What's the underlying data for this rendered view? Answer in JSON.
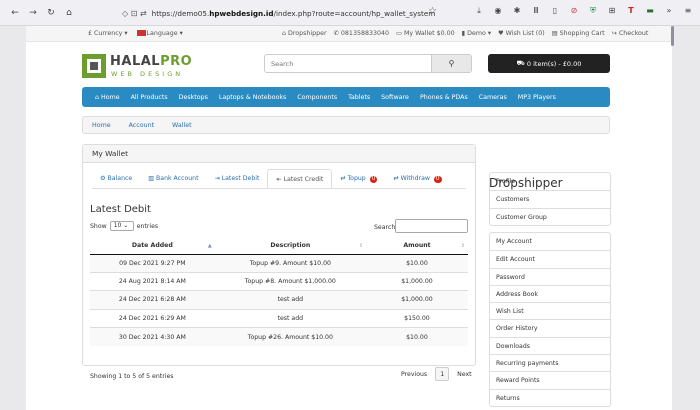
{
  "browser": {
    "url_prefix": "https://demo05.",
    "url_host": "hpwebdesign.id",
    "url_rest": "/index.php?route=account/hp_wallet_system"
  },
  "topnav": {
    "currency": "£ Currency ▾",
    "language": "Language ▾",
    "dropshipper": "Dropshipper",
    "phone": "081358833040",
    "wallet": "My Wallet $0.00",
    "demo": "Demo ▾",
    "wishlist": "Wish List (0)",
    "cart": "Shopping Cart",
    "checkout": "Checkout"
  },
  "header": {
    "brand_main": "HALAL",
    "brand_pro": "PRO",
    "brand_sub": "WEB DESIGN",
    "search_placeholder": "Search",
    "cart_label": "0 item(s) - £0.00"
  },
  "menu": [
    "Home",
    "All Products",
    "Desktops",
    "Laptops & Notebooks",
    "Components",
    "Tablets",
    "Software",
    "Phones & PDAs",
    "Cameras",
    "MP3 Players"
  ],
  "breadcrumb": [
    "Home",
    "Account",
    "Wallet"
  ],
  "wallet": {
    "title": "My Wallet",
    "tabs": [
      {
        "label": "Balance",
        "icon": "gear"
      },
      {
        "label": "Bank Account",
        "icon": "bank"
      },
      {
        "label": "Latest Debit",
        "icon": "sign-out"
      },
      {
        "label": "Latest Credit",
        "icon": "sign-in"
      },
      {
        "label": "Topup",
        "icon": "exchange",
        "badge": "0"
      },
      {
        "label": "Withdraw",
        "icon": "exchange",
        "badge": "0"
      }
    ],
    "section_title": "Latest Debit",
    "show_label": "Show",
    "show_value": "10",
    "entries_label": "entries",
    "search_label": "Search:",
    "columns": [
      "Date Added",
      "Description",
      "Amount"
    ],
    "rows": [
      [
        "09 Dec 2021 9:27 PM",
        "Topup #9. Amount $10.00",
        "$10.00"
      ],
      [
        "24 Aug 2021 8:14 AM",
        "Topup #8. Amount $1,000.00",
        "$1,000.00"
      ],
      [
        "24 Dec 2021 6:28 AM",
        "test add",
        "$1,000.00"
      ],
      [
        "24 Dec 2021 6:29 AM",
        "test add",
        "$150.00"
      ],
      [
        "30 Dec 2021 4:30 AM",
        "Topup #26. Amount $10.00",
        "$10.00"
      ]
    ],
    "info": "Showing 1 to 5 of 5 entries",
    "prev": "Previous",
    "page": "1",
    "next": "Next"
  },
  "sidebar": {
    "title": "Dropshipper",
    "group1": [
      "Profile",
      "Customers",
      "Customer Group"
    ],
    "group2": [
      "My Account",
      "Edit Account",
      "Password",
      "Address Book",
      "Wish List",
      "Order History",
      "Downloads",
      "Recurring payments",
      "Reward Points",
      "Returns"
    ]
  },
  "colors": {
    "accent": "#2a8bc2",
    "brand_green": "#6b9e2e",
    "badge": "#d9230f"
  }
}
